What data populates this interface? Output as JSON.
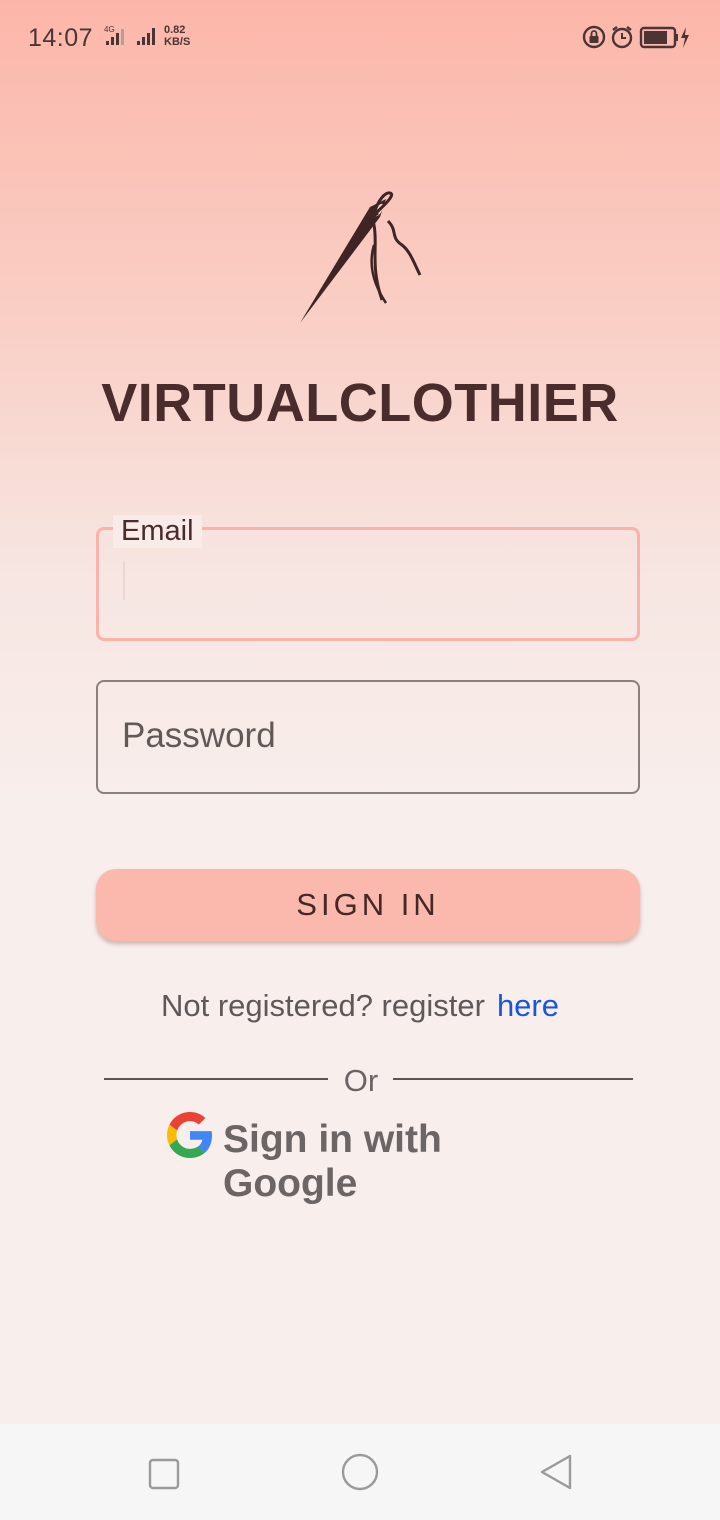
{
  "status_bar": {
    "time": "14:07",
    "network_type": "4G",
    "speed_value": "0.82",
    "speed_unit": "KB/S",
    "icons": [
      "signal-icon",
      "signal-icon",
      "lock-rotation-icon",
      "alarm-icon",
      "battery-charging-icon"
    ]
  },
  "app": {
    "title": "VIRTUALCLOTHIER",
    "logo": "needle-thread-logo"
  },
  "form": {
    "email_label": "Email",
    "email_value": "",
    "password_placeholder": "Password",
    "signin_label": "SIGN IN"
  },
  "register": {
    "prompt": "Not registered? register",
    "link": "here"
  },
  "divider": {
    "label": "Or"
  },
  "google": {
    "label": "Sign in with Google",
    "icon": "google-logo-icon"
  },
  "nav": {
    "icons": [
      "recents-icon",
      "home-icon",
      "back-icon"
    ]
  },
  "colors": {
    "accent": "#fbb8ad",
    "title": "#4a2c2c",
    "link": "#1a56d8"
  }
}
